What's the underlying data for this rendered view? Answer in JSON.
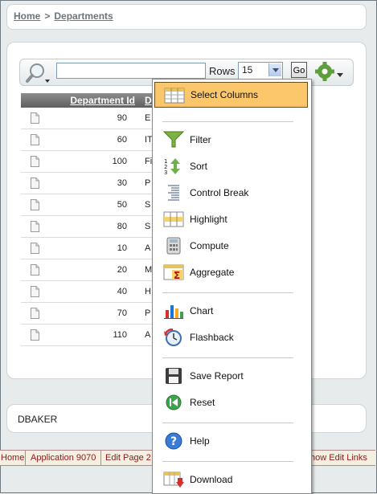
{
  "breadcrumb": {
    "home": "Home",
    "separator": ">",
    "current": "Departments"
  },
  "toolbar": {
    "search_value": "",
    "rows_label": "Rows",
    "rows_value": "15",
    "go_label": "Go"
  },
  "table": {
    "columns": [
      "Department Id",
      "D"
    ],
    "rows": [
      {
        "id": "90",
        "name": "E"
      },
      {
        "id": "60",
        "name": "IT"
      },
      {
        "id": "100",
        "name": "Fi"
      },
      {
        "id": "30",
        "name": "P"
      },
      {
        "id": "50",
        "name": "S"
      },
      {
        "id": "80",
        "name": "S"
      },
      {
        "id": "10",
        "name": "A"
      },
      {
        "id": "20",
        "name": "M"
      },
      {
        "id": "40",
        "name": "H"
      },
      {
        "id": "70",
        "name": "P"
      },
      {
        "id": "110",
        "name": "A"
      }
    ]
  },
  "actions_menu": {
    "items": [
      {
        "label": "Select Columns",
        "icon": "select-columns-icon"
      },
      {
        "label": "Filter",
        "icon": "filter-icon"
      },
      {
        "label": "Sort",
        "icon": "sort-icon"
      },
      {
        "label": "Control Break",
        "icon": "control-break-icon"
      },
      {
        "label": "Highlight",
        "icon": "highlight-icon"
      },
      {
        "label": "Compute",
        "icon": "compute-icon"
      },
      {
        "label": "Aggregate",
        "icon": "aggregate-icon"
      },
      {
        "label": "Chart",
        "icon": "chart-icon"
      },
      {
        "label": "Flashback",
        "icon": "flashback-icon"
      },
      {
        "label": "Save Report",
        "icon": "save-icon"
      },
      {
        "label": "Reset",
        "icon": "reset-icon"
      },
      {
        "label": "Help",
        "icon": "help-icon"
      },
      {
        "label": "Download",
        "icon": "download-icon"
      }
    ]
  },
  "user": {
    "name": "DBAKER"
  },
  "devbar": {
    "home": "Home",
    "application": "Application 9070",
    "edit_page": "Edit Page 2",
    "show_edit_links": "how Edit Links"
  },
  "colors": {
    "menu_highlight": "#fcc66a",
    "devbar_text": "#8b1a1a"
  }
}
